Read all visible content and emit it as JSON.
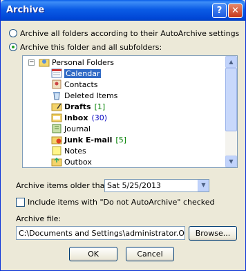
{
  "window": {
    "title": "Archive",
    "help_label": "?",
    "close_label": "✕"
  },
  "options": {
    "archive_all_label": "Archive all folders according to their AutoArchive settings",
    "archive_this_label": "Archive this folder and all subfolders:",
    "selected": "archive_this"
  },
  "tree": {
    "expander": "−",
    "root": "Personal Folders",
    "items": [
      {
        "label": "Calendar",
        "count": "",
        "bold": false,
        "icon": "calendar-icon",
        "selected": true
      },
      {
        "label": "Contacts",
        "count": "",
        "bold": false,
        "icon": "contacts-icon",
        "selected": false
      },
      {
        "label": "Deleted Items",
        "count": "",
        "bold": false,
        "icon": "trash-icon",
        "selected": false
      },
      {
        "label": "Drafts",
        "count": "[1]",
        "bold": true,
        "icon": "drafts-icon",
        "selected": false
      },
      {
        "label": "Inbox",
        "count": "(30)",
        "bold": true,
        "icon": "inbox-icon",
        "selected": false
      },
      {
        "label": "Journal",
        "count": "",
        "bold": false,
        "icon": "journal-icon",
        "selected": false
      },
      {
        "label": "Junk E-mail",
        "count": "[5]",
        "bold": true,
        "icon": "junk-icon",
        "selected": false
      },
      {
        "label": "Notes",
        "count": "",
        "bold": false,
        "icon": "notes-icon",
        "selected": false
      },
      {
        "label": "Outbox",
        "count": "",
        "bold": false,
        "icon": "outbox-icon",
        "selected": false
      }
    ]
  },
  "archive_older": {
    "label": "Archive items older than:",
    "value": "Sat 5/25/2013"
  },
  "include_checkbox": {
    "label": "Include items with \"Do not AutoArchive\" checked",
    "checked": false
  },
  "archive_file": {
    "label": "Archive file:",
    "value": "C:\\Documents and Settings\\administrator.OHIO\\Local Settings",
    "browse_label": "Browse..."
  },
  "buttons": {
    "ok": "OK",
    "cancel": "Cancel"
  },
  "colors": {
    "title_bar": "#0054e3",
    "selection": "#316ac5",
    "dialog_bg": "#ece9d8"
  }
}
